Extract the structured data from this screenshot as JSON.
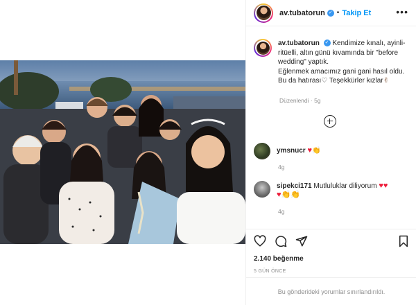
{
  "post": {
    "username": "av.tubatorun",
    "verified_icon": "verified-badge-icon",
    "follow_label": "Takip Et",
    "separator": "•",
    "more_label": "•••",
    "photo_alt": "group selfie on rooftop at dusk"
  },
  "caption": {
    "username": "av.tubatorun",
    "line1": "Kendimize kınalı, ayinli-",
    "line2": "ritüelli, altın günü kıvamında bir \"before",
    "line3": "wedding\" yaptık.",
    "line4": "Eğlenmek amacımız gani gani hasıl oldu.",
    "line5": "Bu da hatırası",
    "line5_heart": "♡",
    "line5_rest": " Teşekkürler kızlar",
    "line5_hand": "✌",
    "edited": "Düzenlendi · 5g"
  },
  "comments": [
    {
      "username": "ymsnucr",
      "text": "",
      "emoji1": "♥",
      "emoji2": "👏",
      "time": "4g"
    },
    {
      "username": "sipekci171",
      "text": "Mutluluklar diliyorum",
      "emoji1": "♥",
      "emoji2": "♥",
      "line2": "♥👏👏",
      "time": "4g"
    }
  ],
  "actions": {
    "like_icon": "heart-icon",
    "comment_icon": "comment-icon",
    "share_icon": "share-icon",
    "save_icon": "bookmark-icon",
    "likes": "2.140 beğenme",
    "ago": "5 GÜN ÖNCE"
  },
  "footer": {
    "limited_text": "Bu gönderideki yorumlar sınırlandırıldı."
  },
  "colors": {
    "accent": "#0095f6",
    "verified": "#3897f0",
    "heart": "#ed1c3a",
    "border": "#efefef",
    "muted": "#8e8e8e"
  }
}
